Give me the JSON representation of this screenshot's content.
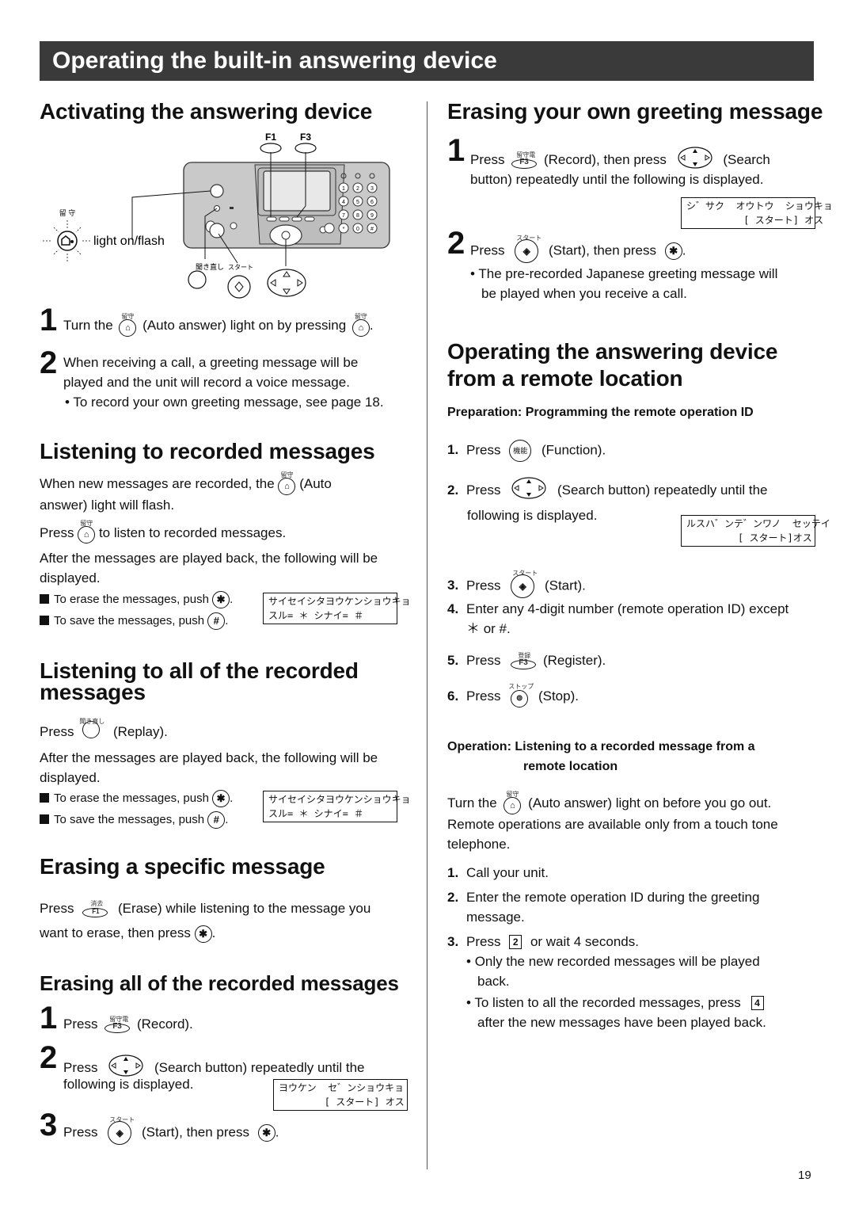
{
  "page": {
    "title": "Operating the built-in answering device",
    "page_number": "19"
  },
  "left": {
    "activating": {
      "heading": "Activating the answering device",
      "diagram": {
        "f1_label": "F1",
        "f3_label": "F3",
        "auto_answer_ruby": "留守",
        "light_label": "light on/flash",
        "replay_ruby": "聞き直し",
        "start_ruby": "スタート",
        "keypad": [
          "1",
          "2",
          "3",
          "4",
          "5",
          "6",
          "7",
          "8",
          "9",
          "*",
          "0",
          "#"
        ]
      },
      "step1_num": "1",
      "step1_a": "Turn the",
      "step1_b": "(Auto answer) light on by pressing",
      "step1_c": ".",
      "step2_num": "2",
      "step2_line1": "When receiving a call, a greeting message will be",
      "step2_line2": "played and the unit will record a voice message.",
      "step2_bullet": "To record your own greeting message, see page 18."
    },
    "listening": {
      "heading": "Listening to recorded messages",
      "p1_a": "When new messages are recorded, the",
      "p1_b": "(Auto",
      "p1_c": "answer) light will flash.",
      "p2_a": "Press",
      "p2_b": "to listen to recorded messages.",
      "p3_line1": "After the messages are played back, the following will be",
      "p3_line2": "displayed.",
      "erase_text": "To erase the messages, push",
      "save_text": "To save the messages, push",
      "lcd_line1": "サイセイシタヨウケンショウキョ",
      "lcd_line2": "スル= ＊ シナイ= ＃"
    },
    "listening_all": {
      "heading_line1": "Listening to all of the recorded",
      "heading_line2": "messages",
      "press": "Press",
      "replay_ruby": "聞き直し",
      "replay": "(Replay).",
      "p_line1": "After the messages are played back, the following will be",
      "p_line2": "displayed.",
      "erase_text": "To erase the messages, push",
      "save_text": "To save the messages, push",
      "lcd_line1": "サイセイシタヨウケンショウキョ",
      "lcd_line2": "スル= ＊ シナイ= ＃"
    },
    "erasing_specific": {
      "heading": "Erasing a specific message",
      "press": "Press",
      "erase_ruby": "消去",
      "key": "F1",
      "line1": "(Erase) while listening to the message you",
      "line2": "want to erase, then press",
      "end": "."
    },
    "erasing_all": {
      "heading": "Erasing all of the recorded messages",
      "s1_num": "1",
      "s1_press": "Press",
      "s1_ruby": "留守電",
      "s1_key": "F3",
      "s1_text": "(Record).",
      "s2_num": "2",
      "s2_press": "Press",
      "s2_text": "(Search button) repeatedly until the",
      "s2_line2": "following is displayed.",
      "lcd_line1": "ヨウケン  セ゛ンショウキョ",
      "lcd_line2": "        [ スタート] オス",
      "s3_num": "3",
      "s3_press": "Press",
      "s3_ruby": "スタート",
      "s3_text": "(Start), then press",
      "s3_end": "."
    }
  },
  "right": {
    "erasing_greeting": {
      "heading": "Erasing your own greeting message",
      "s1_num": "1",
      "s1_press": "Press",
      "s1_ruby": "留守電",
      "s1_key": "F3",
      "s1_text": "(Record), then press",
      "s1_text2": "(Search",
      "s1_line2": "button) repeatedly until the following is displayed.",
      "lcd_line1": "シ゛サク  オウトウ  ショウキョ",
      "lcd_line2": "          [ スタート] オス",
      "s2_num": "2",
      "s2_press": "Press",
      "s2_ruby": "スタート",
      "s2_text": "(Start), then press",
      "s2_end": ".",
      "s2_bullet_line1": "The pre-recorded Japanese greeting message will",
      "s2_bullet_line2": "be played when you receive a call."
    },
    "remote": {
      "heading_line1": "Operating the answering device",
      "heading_line2": "from a remote location",
      "prep_heading": "Preparation: Programming the remote operation ID",
      "prep_steps": [
        {
          "num": "1.",
          "press": "Press",
          "icon_label": "機能",
          "text": "(Function)."
        },
        {
          "num": "2.",
          "press": "Press",
          "text": "(Search button) repeatedly until the",
          "line2": "following is displayed."
        },
        {
          "num": "3.",
          "press": "Press",
          "ruby": "スタート",
          "text": "(Start)."
        },
        {
          "num": "4.",
          "text": "Enter any 4-digit number (remote operation ID) except",
          "line2": "＊ or #."
        },
        {
          "num": "5.",
          "press": "Press",
          "ruby": "登録",
          "key": "F3",
          "text": "(Register)."
        },
        {
          "num": "6.",
          "press": "Press",
          "ruby": "ストップ",
          "text": "(Stop)."
        }
      ],
      "lcd_line1": "ルスハ゛ンテ゛ンワノ  セッテイ",
      "lcd_line2": "         [ スタート]オス",
      "op_heading_a": "Operation:",
      "op_heading_b": "Listening to a recorded message from a",
      "op_heading_c": "remote location",
      "op_p_a": "Turn the",
      "op_p_ruby": "留守",
      "op_p_b": "(Auto answer) light on before you go out.",
      "op_p_line2": "Remote operations are available only from a touch tone",
      "op_p_line3": "telephone.",
      "op_steps": [
        {
          "num": "1.",
          "text": "Call your unit."
        },
        {
          "num": "2.",
          "text": "Enter the remote operation ID during the greeting",
          "line2": "message."
        },
        {
          "num": "3.",
          "press": "Press",
          "key": "2",
          "text": "or wait 4 seconds."
        }
      ],
      "bullet1_line1": "Only the new recorded messages will be played",
      "bullet1_line2": "back.",
      "bullet2_line1": "To listen to all the recorded messages, press",
      "bullet2_key": "4",
      "bullet2_line2": "after the new messages have been played back."
    }
  }
}
